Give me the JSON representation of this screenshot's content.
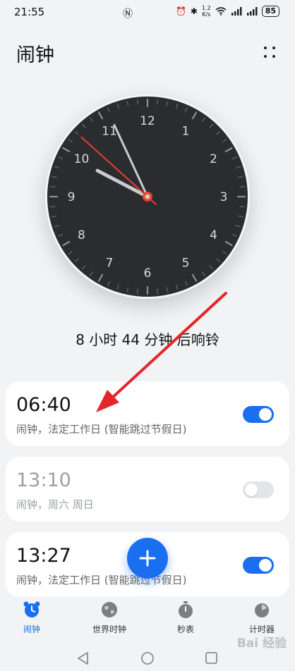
{
  "status": {
    "time": "21:55",
    "net_speed_value": "1.2",
    "net_speed_unit": "K/s",
    "battery": "85"
  },
  "header": {
    "title": "闹钟"
  },
  "clock": {
    "numbers": [
      "12",
      "1",
      "2",
      "3",
      "4",
      "5",
      "6",
      "7",
      "8",
      "9",
      "10",
      "11"
    ],
    "hour": 9,
    "minute": 55,
    "second": 52
  },
  "countdown": "8 小时 44 分钟 后响铃",
  "alarms": [
    {
      "time": "06:40",
      "desc": "闹钟，法定工作日 (智能跳过节假日)",
      "enabled": true
    },
    {
      "time": "13:10",
      "desc": "闹钟，周六 周日",
      "enabled": false
    },
    {
      "time": "13:27",
      "desc": "闹钟，法定工作日 (智能跳过节假日)",
      "enabled": true
    }
  ],
  "tabs": [
    {
      "label": "闹钟",
      "icon": "alarm-clock-icon",
      "active": true
    },
    {
      "label": "世界时钟",
      "icon": "globe-icon",
      "active": false
    },
    {
      "label": "秒表",
      "icon": "stopwatch-icon",
      "active": false
    },
    {
      "label": "计时器",
      "icon": "timer-icon",
      "active": false
    }
  ],
  "watermark": "Bai 经验",
  "colors": {
    "accent": "#1a6ff0",
    "clock_face": "#2b2c2f",
    "second_hand": "#e8402a",
    "annotation_arrow": "#e5252a"
  }
}
